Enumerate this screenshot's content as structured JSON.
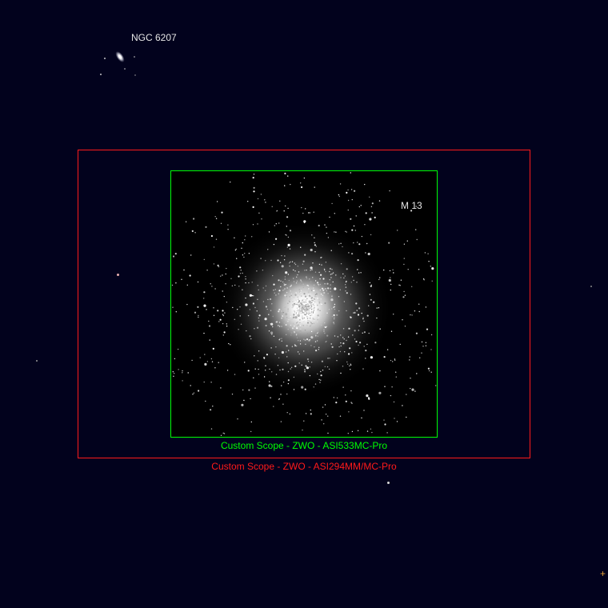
{
  "objects": {
    "galaxy": {
      "name": "NGC 6207"
    },
    "cluster": {
      "name": "M 13"
    }
  },
  "fov_outlines": [
    {
      "label": "Custom Scope - ZWO - ASI533MC-Pro",
      "color": "#00ff00"
    },
    {
      "label": "Custom Scope - ZWO - ASI294MM/MC-Pro",
      "color": "#ff1a1a"
    }
  ],
  "colors": {
    "sky_background": "#02021d",
    "image_background": "#000000",
    "object_label": "#e6e6e6",
    "marker": "#e8a33c"
  },
  "marker": {
    "glyph": "+"
  }
}
